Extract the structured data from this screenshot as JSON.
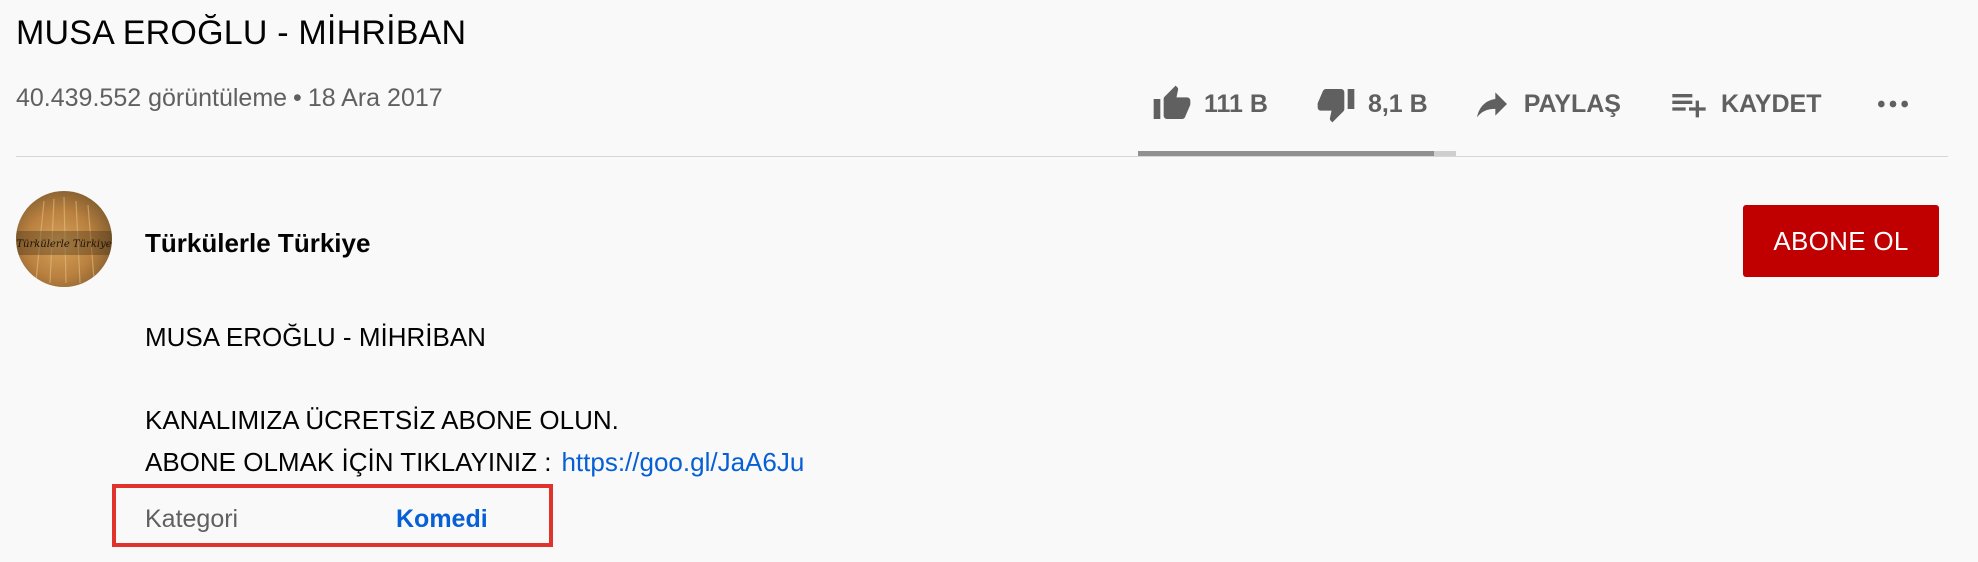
{
  "video": {
    "title": "MUSA EROĞLU - MİHRİBAN",
    "views": "40.439.552 görüntüleme",
    "separator": "•",
    "date": "18 Ara 2017"
  },
  "actions": {
    "like_count": "111 B",
    "dislike_count": "8,1 B",
    "share_label": "PAYLAŞ",
    "save_label": "KAYDET",
    "like_ratio": 0.93
  },
  "channel": {
    "name": "Türkülerle Türkiye",
    "subscribe_label": "ABONE OL",
    "avatar_text": "Türkülerle Türkiye"
  },
  "description": {
    "line1": "MUSA EROĞLU - MİHRİBAN",
    "line2": "KANALIMIZA ÜCRETSİZ ABONE OLUN.",
    "line3": "ABONE OLMAK İÇİN TIKLAYINIZ :",
    "link": "https://goo.gl/JaA6Ju"
  },
  "metadata": {
    "category_label": "Kategori",
    "category_value": "Komedi"
  },
  "colors": {
    "subscribe_bg": "#c00000",
    "link": "#065fd4",
    "highlight_box": "#e0332b"
  }
}
